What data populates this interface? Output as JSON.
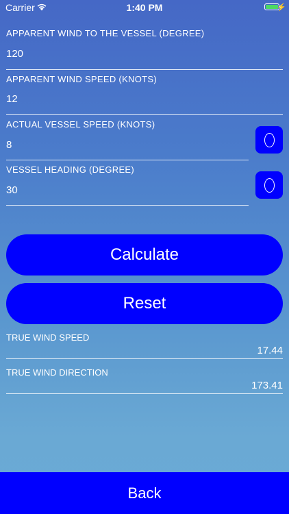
{
  "status_bar": {
    "carrier": "Carrier",
    "time": "1:40 PM",
    "battery_color": "#4cd964"
  },
  "inputs": {
    "apparent_wind_direction": {
      "label": "APPARENT WIND TO THE VESSEL (DEGREE)",
      "value": "120"
    },
    "apparent_wind_speed": {
      "label": "APPARENT WIND SPEED (KNOTS)",
      "value": "12"
    },
    "vessel_speed": {
      "label": "ACTUAL VESSEL SPEED (KNOTS)",
      "value": "8",
      "toggle_icon": "ring-icon"
    },
    "vessel_heading": {
      "label": "VESSEL HEADING (DEGREE)",
      "value": "30",
      "toggle_icon": "ring-icon"
    }
  },
  "buttons": {
    "calculate": "Calculate",
    "reset": "Reset",
    "back": "Back",
    "accent_color": "#0000ff"
  },
  "results": {
    "true_wind_speed": {
      "label": "TRUE WIND SPEED",
      "value": "17.44"
    },
    "true_wind_direction": {
      "label": "TRUE WIND DIRECTION",
      "value": "173.41"
    }
  }
}
